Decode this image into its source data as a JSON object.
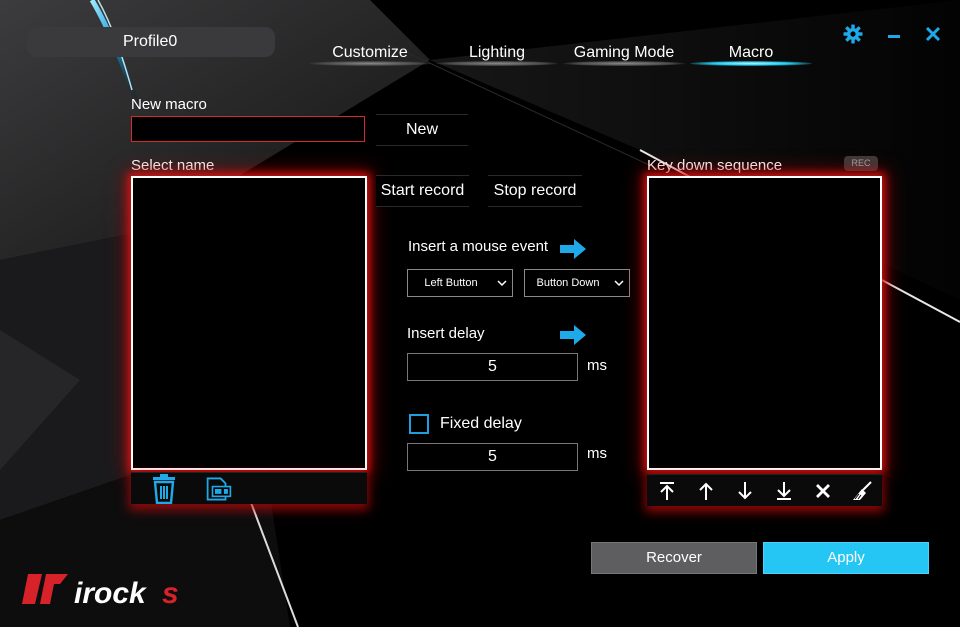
{
  "header": {
    "profile_name": "Profile0",
    "tabs": [
      {
        "label": "Customize",
        "active": false
      },
      {
        "label": "Lighting",
        "active": false
      },
      {
        "label": "Gaming Mode",
        "active": false
      },
      {
        "label": "Macro",
        "active": true
      }
    ],
    "controls": {
      "settings_icon": "gear-icon",
      "minimize_icon": "minimize-icon",
      "close_icon": "close-icon"
    }
  },
  "macro": {
    "new_macro_label": "New macro",
    "new_macro_value": "",
    "new_button": "New",
    "select_name_label": "Select name",
    "start_record": "Start record",
    "stop_record": "Stop record",
    "key_down_label": "Key down sequence",
    "rec_badge": "REC",
    "insert_mouse_label": "Insert a mouse event",
    "mouse_button_selected": "Left Button",
    "mouse_action_selected": "Button Down",
    "insert_delay_label": "Insert delay",
    "delay_value": "5",
    "delay_unit": "ms",
    "fixed_delay_label": "Fixed delay",
    "fixed_delay_checked": false,
    "fixed_delay_value": "5",
    "fixed_delay_unit": "ms"
  },
  "footer": {
    "recover": "Recover",
    "apply": "Apply",
    "brand": "irocks"
  },
  "colors": {
    "accent_blue": "#25c6f4",
    "icon_blue": "#1fa9e8",
    "glow_red": "#e61414",
    "brand_red": "#d8222a"
  }
}
